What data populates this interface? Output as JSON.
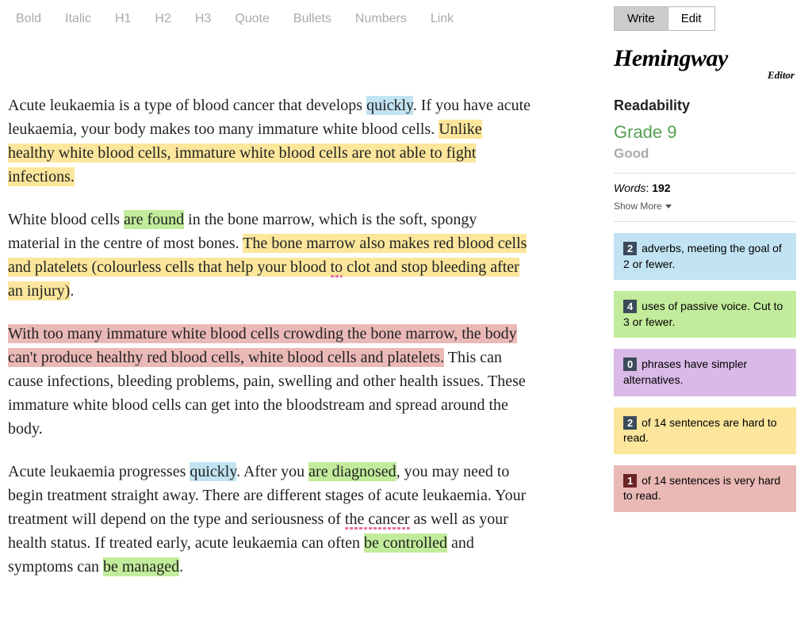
{
  "toolbar": {
    "bold": "Bold",
    "italic": "Italic",
    "h1": "H1",
    "h2": "H2",
    "h3": "H3",
    "quote": "Quote",
    "bullets": "Bullets",
    "numbers": "Numbers",
    "link": "Link"
  },
  "sidebar": {
    "mode_write": "Write",
    "mode_edit": "Edit",
    "logo_main": "Hemingway",
    "logo_sub": "Editor",
    "readability_label": "Readability",
    "grade": "Grade 9",
    "grade_sub": "Good",
    "words_label": "Words",
    "words_value": "192",
    "showmore": "Show More",
    "stats": {
      "adverb": {
        "count": "2",
        "text": " adverbs, meeting the goal of 2 or fewer."
      },
      "passive": {
        "count": "4",
        "text": " uses of passive voice. Cut to 3 or fewer."
      },
      "phrase": {
        "count": "0",
        "text": " phrases have simpler alternatives."
      },
      "hard": {
        "count": "2",
        "text": " of 14 sentences are hard to read."
      },
      "veryhard": {
        "count": "1",
        "text": " of 14 sentences is very hard to read."
      }
    }
  },
  "content": {
    "p1_a": "Acute leukaemia is a type of blood cancer that develops ",
    "p1_adv1": "quickly",
    "p1_b": ". If you have acute leukaemia, your body makes too many immature white blood cells. ",
    "p1_hard": "Unlike healthy white blood cells, immature white blood cells are not able to fight infections.",
    "p2_a": "White blood cells ",
    "p2_pass": "are found",
    "p2_b": " in the bone marrow, which is the soft, spongy material in the centre of most bones. ",
    "p2_hard_a": "The bone marrow also makes red blood cells and platelets (colourless cells that help your blood ",
    "p2_hard_wig": "to",
    "p2_hard_b": " clot and stop bleeding after an injury)",
    "p2_c": ".",
    "p3_vh": "With too many immature white blood cells crowding the bone marrow, the body can't produce healthy red blood cells, white blood cells and platelets.",
    "p3_a": " This can cause infections, bleeding problems, pain, swelling and other health issues. These immature white blood cells can get into the bloodstream and spread around the body.",
    "p4_a": "Acute leukaemia progresses ",
    "p4_adv": "quickly",
    "p4_b": ". After you ",
    "p4_pass1": "are diagnosed",
    "p4_c": ", you may need to begin treatment straight away. There are different stages of acute leukaemia. Your treatment will depend on the type and seriousness of ",
    "p4_wig": "the cancer",
    "p4_d": " as well as your health status. If treated early, acute leukaemia can often ",
    "p4_pass2": "be controlled",
    "p4_e": " and symptoms can ",
    "p4_pass3": "be managed",
    "p4_f": "."
  }
}
